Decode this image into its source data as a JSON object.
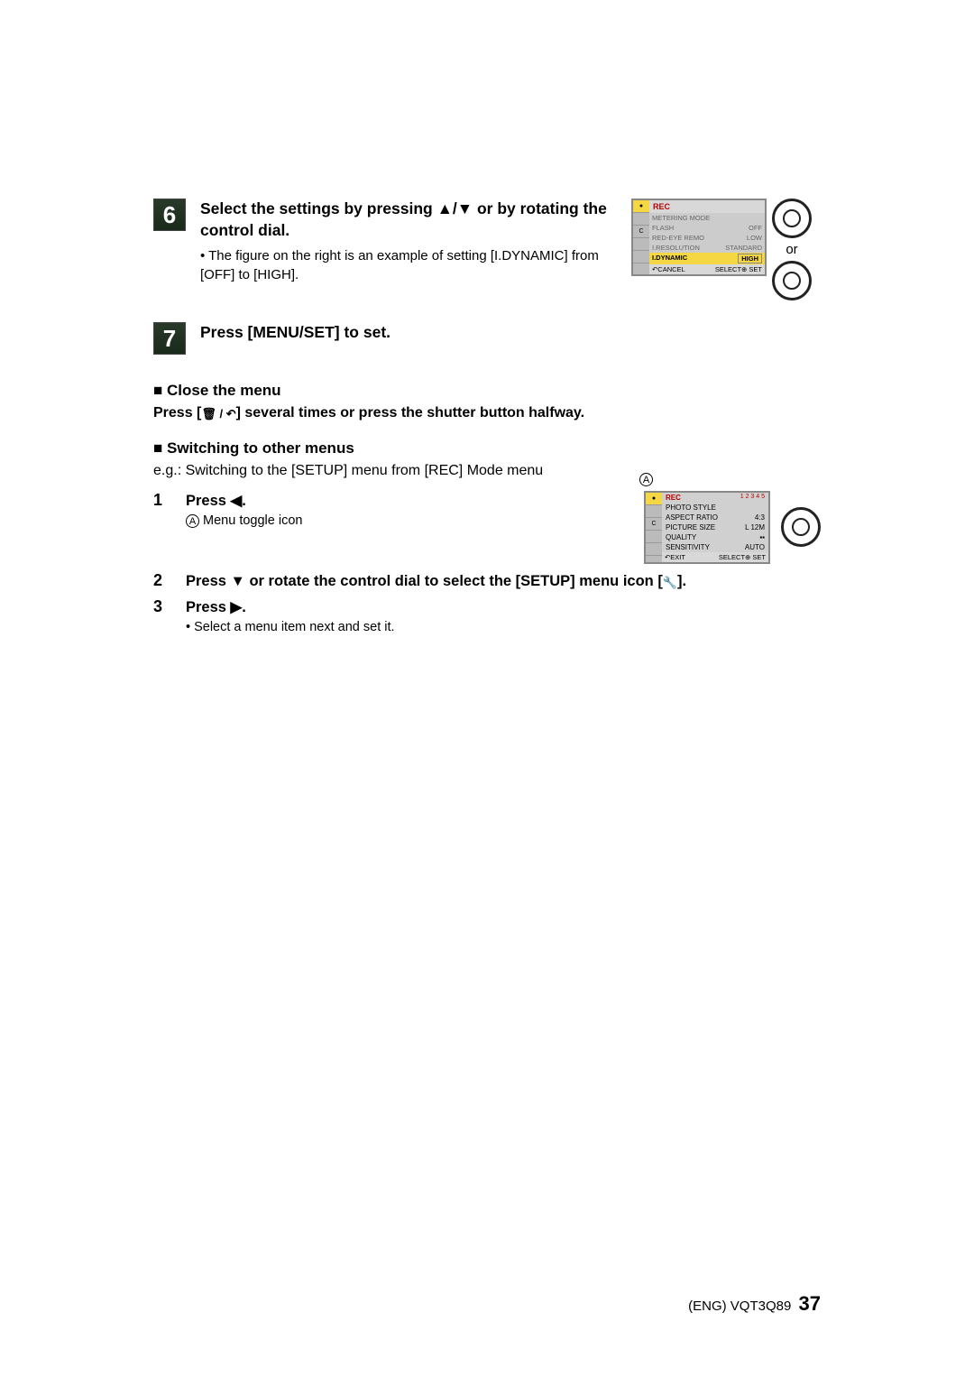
{
  "steps": {
    "s6": {
      "num": "6",
      "heading_p1": "Select the settings by pressing ",
      "heading_arrows": "▲/▼",
      "heading_p2": " or by rotating the control dial.",
      "bullet": "• The figure on the right is an example of setting [I.DYNAMIC] from [OFF] to [HIGH]."
    },
    "s7": {
      "num": "7",
      "heading": "Press [MENU/SET] to set."
    }
  },
  "screen1": {
    "title": "REC",
    "items": [
      {
        "name": "METERING MODE",
        "val": ""
      },
      {
        "name": "FLASH",
        "val": "OFF"
      },
      {
        "name": "RED-EYE REMO",
        "val": "LOW"
      },
      {
        "name": "I.RESOLUTION",
        "val": "STANDARD"
      },
      {
        "name": "I.DYNAMIC",
        "val": "HIGH"
      }
    ],
    "footer_left": "↶CANCEL",
    "footer_right": "SELECT⊕ SET"
  },
  "or_text": "or",
  "close": {
    "head": "■ Close the menu",
    "text_p1": "Press [",
    "text_icon": "🗑 / ↶",
    "text_p2": "] several times or press the shutter button halfway."
  },
  "switching": {
    "head": "■ Switching to other menus",
    "eg": "e.g.: Switching to the [SETUP] menu from [REC] Mode menu"
  },
  "numbered": {
    "n1": {
      "num": "1",
      "head": "Press ◀.",
      "sub_icon": "A",
      "sub": "Menu toggle icon"
    },
    "n2": {
      "num": "2",
      "head_p1": "Press ▼ or rotate the control dial to select the [SETUP] menu icon [",
      "head_icon": "🔧",
      "head_p2": "]."
    },
    "n3": {
      "num": "3",
      "head": "Press ▶.",
      "bullet": "• Select a menu item next and set it."
    }
  },
  "screen2": {
    "marker": "A",
    "title": "REC",
    "pages": "1 2 3 4 5",
    "items": [
      {
        "name": "PHOTO STYLE",
        "val": ""
      },
      {
        "name": "ASPECT RATIO",
        "val": "4:3"
      },
      {
        "name": "PICTURE SIZE",
        "val": "L 12M"
      },
      {
        "name": "QUALITY",
        "val": "▪▪"
      },
      {
        "name": "SENSITIVITY",
        "val": "AUTO"
      }
    ],
    "footer_left": "↶EXIT",
    "footer_right": "SELECT⊕ SET"
  },
  "footer": {
    "doc": "(ENG) VQT3Q89",
    "page": "37"
  }
}
